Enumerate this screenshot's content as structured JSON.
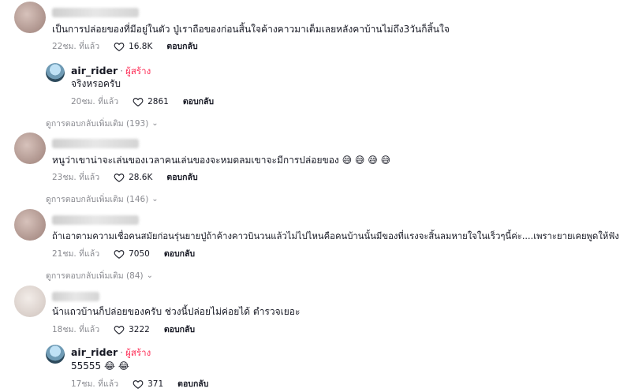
{
  "comments": [
    {
      "text": "เป็นการปล่อยของที่มีอยู่ในตัว ปู่เราถือของก่อนสิ้นใจค้างคาวมาเต็มเลยหลังคาบ้านไม่ถึง3วันก็สิ้นใจ",
      "time": "22ชม. ที่แล้ว",
      "likes": "16.8K",
      "reply_label": "ตอบกลับ",
      "reply": {
        "username": "air_rider",
        "badge": "ผู้สร้าง",
        "text": "จริงหรอครับ",
        "time": "20ชม. ที่แล้ว",
        "likes": "2861",
        "reply_label": "ตอบกลับ"
      },
      "view_more": "ดูการตอบกลับเพิ่มเติม (193)"
    },
    {
      "text": "หนูว่าเขาน่าจะเล่นของเวลาคนเล่นของจะหมดลมเขาจะมีการปล่อยของ 😅 😅 😅 😅",
      "time": "23ชม. ที่แล้ว",
      "likes": "28.6K",
      "reply_label": "ตอบกลับ",
      "view_more": "ดูการตอบกลับเพิ่มเติม (146)"
    },
    {
      "text": "ถ้าเอาตามความเชื่อคนสมัยก่อนรุ่นยายปู่ถ้าค้างคาวบินวนแล้วไม่ไปไหนคือคนบ้านนั้นมีของที่แรงจะสิ้นลมหายใจในเร็วๆนี้ค่ะ....เพราะยายเคยพูดให้ฟัง",
      "time": "21ชม. ที่แล้ว",
      "likes": "7050",
      "reply_label": "ตอบกลับ",
      "view_more": "ดูการตอบกลับเพิ่มเติม (84)"
    },
    {
      "text": "น้าแถวบ้านก็ปล่อยของครับ ช่วงนี้ปล่อยไม่ค่อยได้ ตำรวจเยอะ",
      "time": "18ชม. ที่แล้ว",
      "likes": "3222",
      "reply_label": "ตอบกลับ",
      "reply": {
        "username": "air_rider",
        "badge": "ผู้สร้าง",
        "text": "55555 😂 😂",
        "time": "17ชม. ที่แล้ว",
        "likes": "371",
        "reply_label": "ตอบกลับ"
      }
    }
  ],
  "icons": {
    "like": "heart-outline-icon",
    "expand": "chevron-down-icon"
  }
}
